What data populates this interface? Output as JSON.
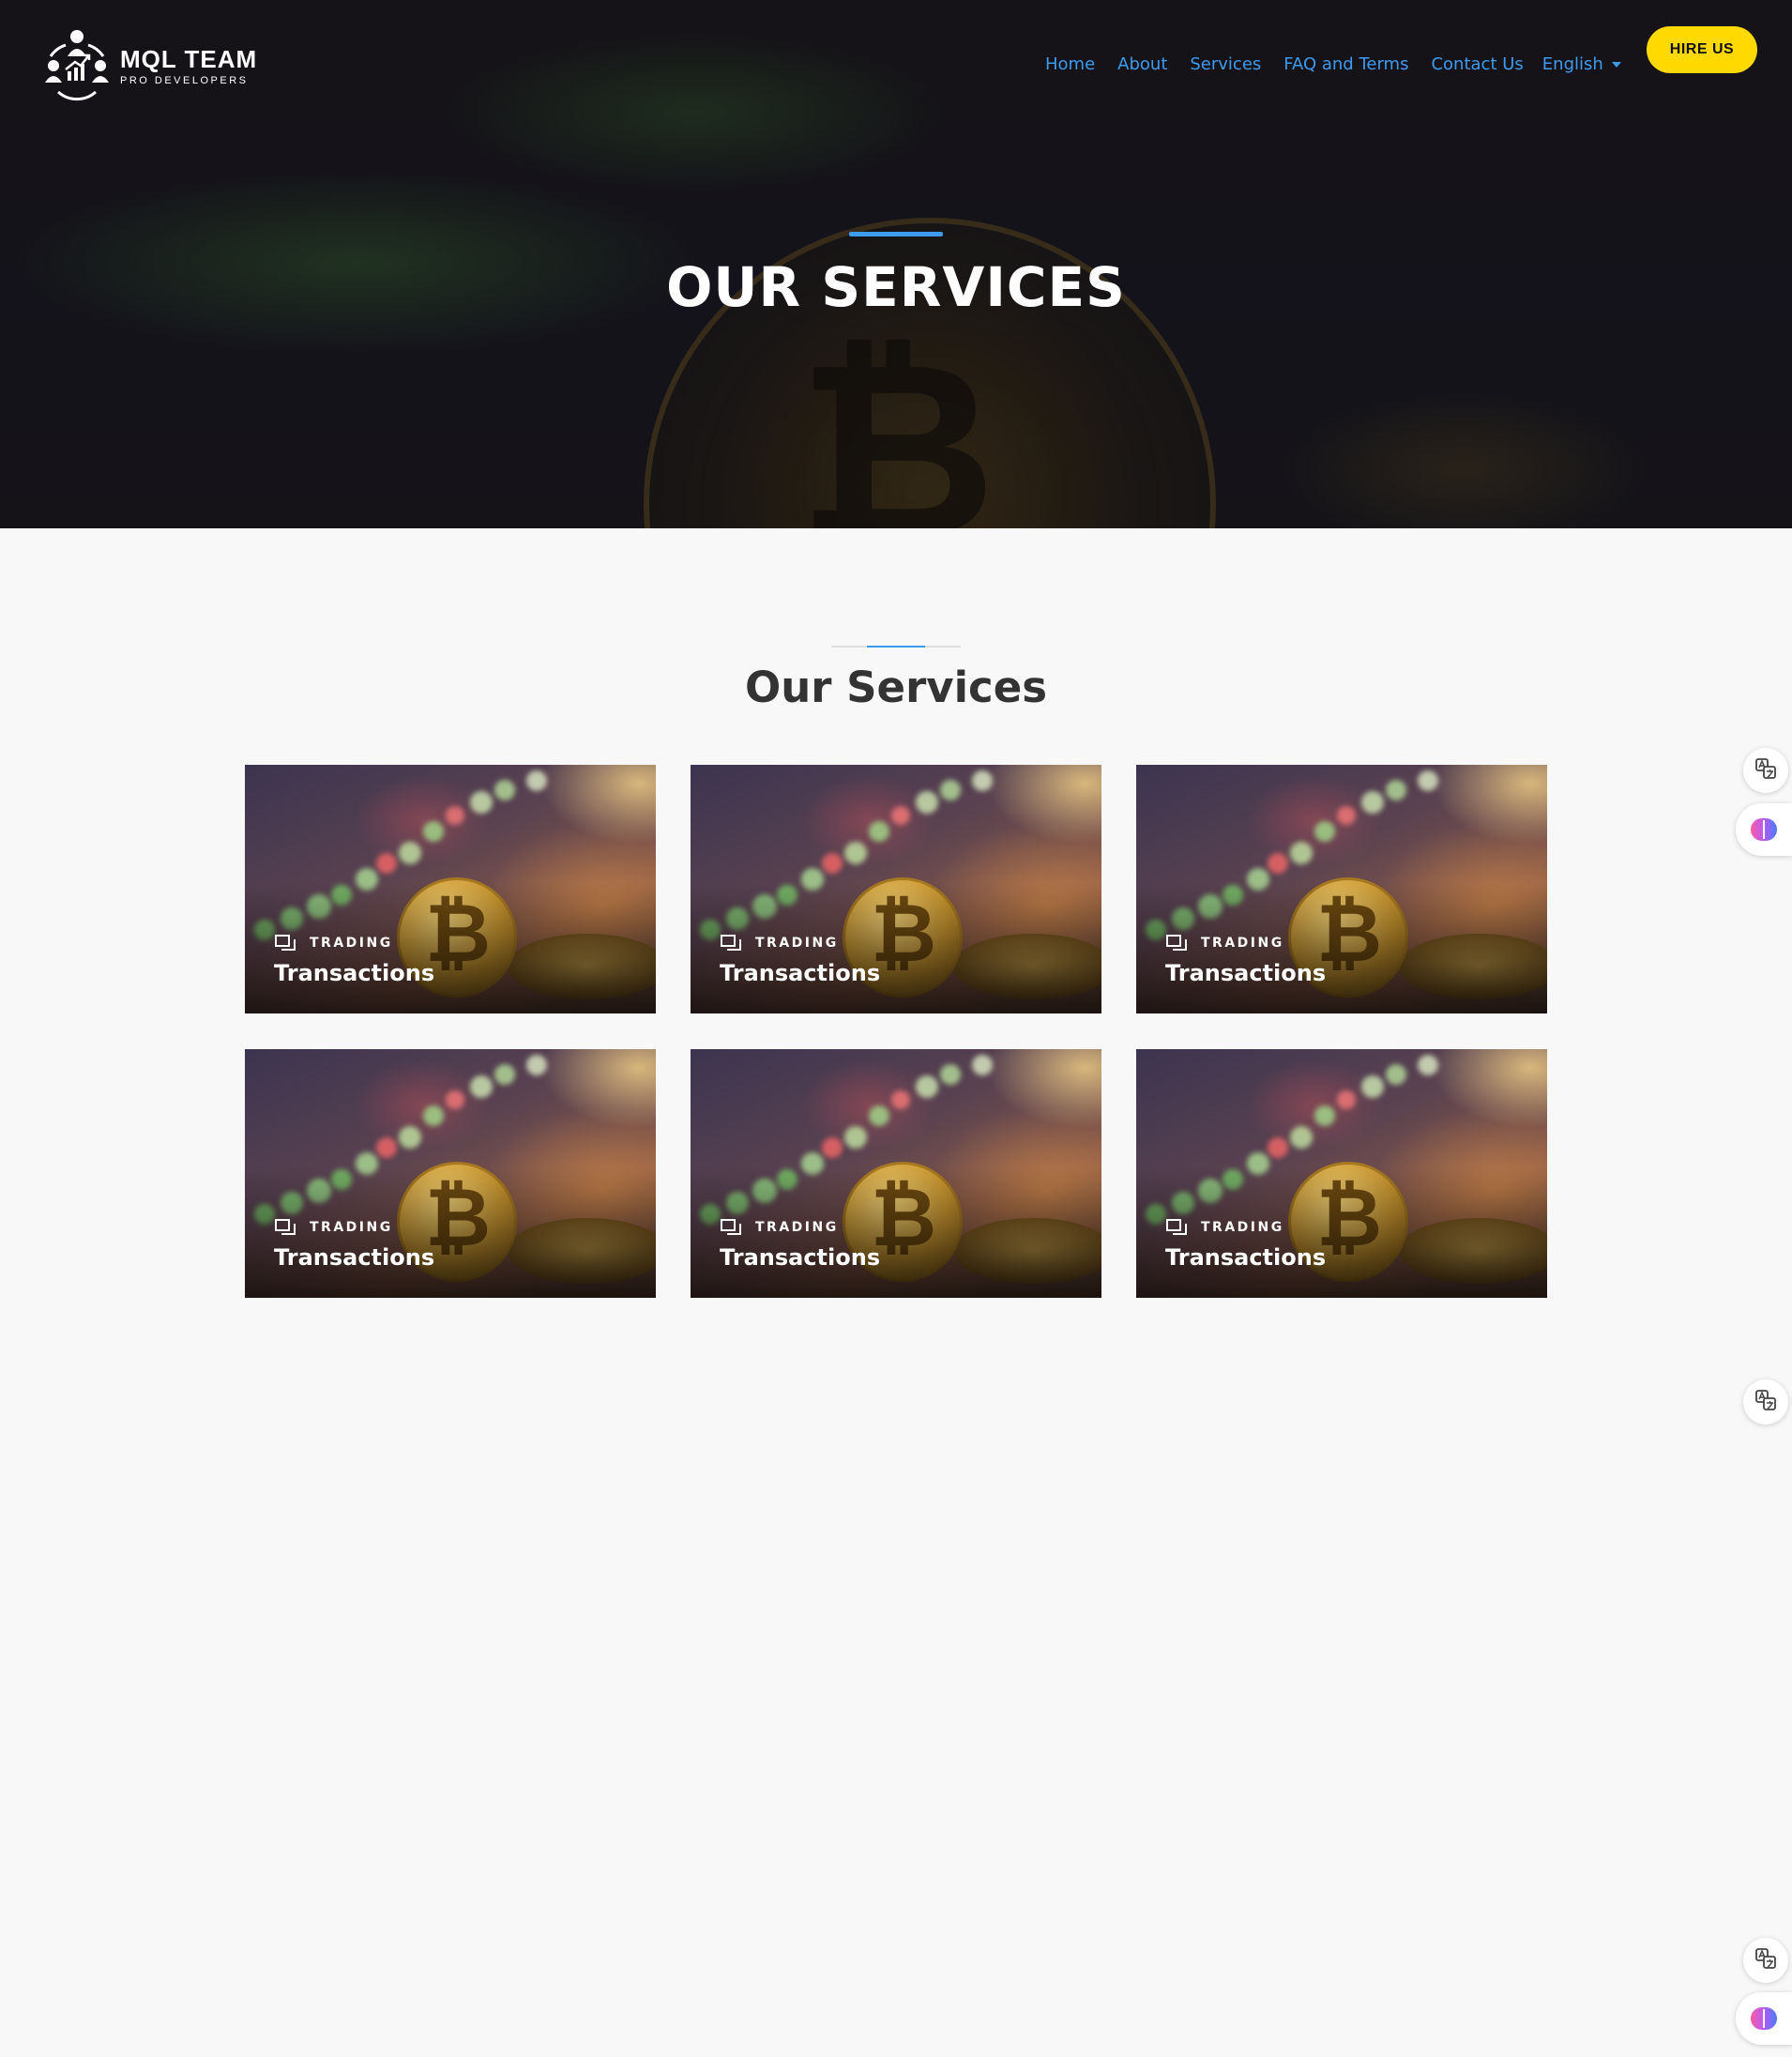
{
  "brand": {
    "name": "MQL TEAM",
    "tagline": "PRO DEVELOPERS"
  },
  "nav": {
    "items": [
      {
        "label": "Home"
      },
      {
        "label": "About"
      },
      {
        "label": "Services"
      },
      {
        "label": "FAQ and Terms"
      },
      {
        "label": "Contact Us"
      }
    ],
    "language": "English"
  },
  "hire_button": "HIRE US",
  "hero": {
    "title": "OUR SERVICES"
  },
  "section": {
    "title": "Our Services"
  },
  "cards": [
    {
      "category": "TRADING",
      "title": "Transactions"
    },
    {
      "category": "TRADING",
      "title": "Transactions"
    },
    {
      "category": "TRADING",
      "title": "Transactions"
    },
    {
      "category": "TRADING",
      "title": "Transactions"
    },
    {
      "category": "TRADING",
      "title": "Transactions"
    },
    {
      "category": "TRADING",
      "title": "Transactions"
    }
  ],
  "colors": {
    "accent": "#3d9bf0",
    "hire_button": "#ffd900",
    "page_background": "#f8f8f8",
    "section_title": "#333333"
  },
  "icons": {
    "logo": "team-growth-logo",
    "card_category": "copy-icon",
    "widget_translate": "translate-icon",
    "widget_ai": "brain-icon"
  }
}
